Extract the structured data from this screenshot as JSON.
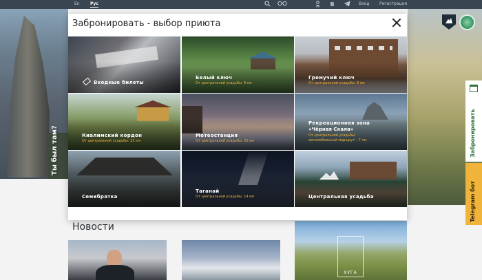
{
  "topbar": {
    "lang_en": "En",
    "lang_ru": "Рус",
    "login": "Вход",
    "register": "Регистрация",
    "icons": [
      "search-icon",
      "glasses-icon",
      "odnoklassniki-icon",
      "vk-icon",
      "telegram-icon"
    ],
    "vk_glyph": "В"
  },
  "background": {
    "rock_label": "Ты был там?",
    "side_book": "Забронировать",
    "side_telegram": "Telegram бот",
    "news_title": "Новости",
    "badge_text": "ХУГА"
  },
  "modal": {
    "title": "Забронировать - выбор приюта",
    "cards": [
      {
        "name": "Входные билеты",
        "sub": ""
      },
      {
        "name": "Белый ключ",
        "sub": "От центральной усадьбы: 6 км"
      },
      {
        "name": "Гремучий ключ",
        "sub": "От центральной усадьбы: 8 км"
      },
      {
        "name": "Киалимский кордон",
        "sub": "От центральной усадьбы: 23 км"
      },
      {
        "name": "Метеостанция",
        "sub": "От центральной усадьбы: 25 км"
      },
      {
        "name_line1": "Рекреационная зона",
        "name_line2": "«Чёрная Скала»",
        "sub_line1": "От центральной усадьбы:",
        "sub_line2": "автомобильный маршрут – 7 км"
      },
      {
        "name": "Семибратка",
        "sub": ""
      },
      {
        "name": "Таганай",
        "sub": "От центральной усадьбы: 14 км"
      },
      {
        "name": "Центральная усадьба",
        "sub": ""
      }
    ]
  },
  "colors": {
    "topbar": "#3a4552",
    "accent_yellow": "#f0b43a",
    "brand_green": "#2f6f3f"
  }
}
